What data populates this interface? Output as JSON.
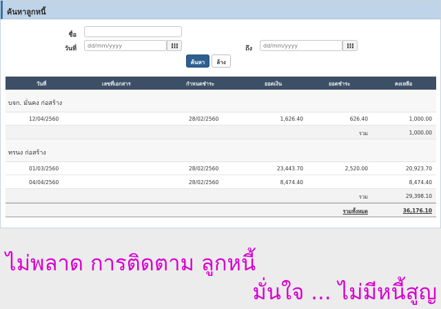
{
  "panel": {
    "title": "ค้นหาลูกหนี้"
  },
  "form": {
    "name_label": "ชื่อ",
    "date_label": "วันที่",
    "to_label": "ถึง",
    "name_value": "",
    "from_placeholder": "dd/mm/yyyy",
    "to_placeholder": "dd/mm/yyyy",
    "search_button": "ค้นหา",
    "clear_button": "ล้าง"
  },
  "table": {
    "headers": [
      "วันที่",
      "เลขที่เอกสาร",
      "กำหนดชำระ",
      "ยอดเงิน",
      "ยอดชำระ",
      "คงเหลือ"
    ],
    "groups": [
      {
        "name": "บจก. มั่นคง ก่อสร้าง",
        "rows": [
          {
            "date": "12/04/2560",
            "doc": "",
            "due": "28/02/2560",
            "amount": "1,626.40",
            "paid": "626.40",
            "balance": "1,000.00"
          }
        ],
        "sum_label": "รวม",
        "sum": "1,000.00"
      },
      {
        "name": "ทรนง ก่อสร้าง",
        "rows": [
          {
            "date": "01/03/2560",
            "doc": "",
            "due": "28/02/2560",
            "amount": "23,443.70",
            "paid": "2,520.00",
            "balance": "20,923.70"
          },
          {
            "date": "04/04/2560",
            "doc": "",
            "due": "28/02/2560",
            "amount": "8,474.40",
            "paid": "",
            "balance": "8,474.40"
          }
        ],
        "sum_label": "รวม",
        "sum": "29,398.10"
      }
    ],
    "total_label": "รวมทั้งหมด",
    "total": "36,176.10"
  },
  "overlay": {
    "line1": "ไม่พลาด การติดตาม ลูกหนี้",
    "line2": "มั่นใจ ... ไม่มีหนี้สูญ"
  },
  "colors": {
    "header_bg": "#3d4f66",
    "panel_head": "#bfd4e8",
    "overlay_text": "#d800d0",
    "primary_btn": "#2f5f8f"
  }
}
